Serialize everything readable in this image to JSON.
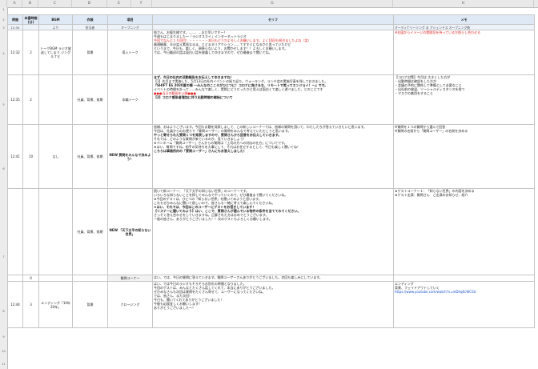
{
  "col_headers": [
    "",
    "A",
    "B",
    "C",
    "D",
    "E",
    "F",
    "G",
    "H"
  ],
  "row_numbers": [
    "1",
    "2",
    "3",
    "4",
    "5",
    "6",
    "7",
    "8",
    "9",
    "10",
    "11"
  ],
  "table": {
    "headers": [
      "時間",
      "本番時間(分)",
      "BGM",
      "衣装",
      "項目",
      "セリフ",
      "メモ"
    ],
    "sub_headers": [
      "",
      "",
      "より",
      "担当者",
      "オープニング",
      "",
      "オーディナリーソング ＆ アシェンドス オープニング曲"
    ],
    "sub_time": "12:30",
    "rows": [
      {
        "time": "12:32",
        "minutes": "2",
        "bgm": "トークBGM ラジオ放送してしまう ジングルナビ",
        "costume": "背景",
        "item": "導入トーク",
        "script": [
          {
            "t": "皆さん、お疲れ様です。……、…まだ早いですー！",
            "c": ""
          },
          {
            "t": "今週もはじまりました〜「ラジオスカイ」インターネットラジオ",
            "c": ""
          },
          {
            "t": "今回でなんと１０回目！・・・・・・本日もどうかよろしくお願いします。よく10回も続きましたよね（笑）",
            "c": "red"
          },
          {
            "t": "最通観客、半分笑え素直なまま、とどまるリアクション……てすすぐになるかと思っていたけど",
            "c": ""
          },
          {
            "t": "というまで、今日も、楽しく、頑張らないよう、お聞かせします！！よろしくお願いします。",
            "c": ""
          },
          {
            "t": "では、今日最初の話は面白い話を披露してゆきますので、ぜひ最後まで聞いてね。",
            "c": ""
          }
        ],
        "memo": [
          {
            "t": "※右図からイメージの雰囲気を持っているか照らし合わせる",
            "c": "red"
          }
        ]
      },
      {
        "time": "12:35",
        "minutes": "2",
        "bgm": "",
        "costume": "社員、背景、前期",
        "item": "本編トーク",
        "script": [
          {
            "t": "まず、今日の社内の活動報告をお伝えしてゆきますね！",
            "c": "bold"
          },
          {
            "t": "【1】先月まで実施した、5月13日の社内イベントの振り返り。ウォーキング、ランチ会の実施写真を残しておきました。",
            "c": ""
          },
          {
            "t": "『SHIFT ES  2020夏の陣 〜みんなのこころがひとつに！コロナに負けるな、リモートで笑ってエンジョイ！〜』です。",
            "c": "bold"
          },
          {
            "t": "イベントの時間を計って……みんなで楽しく、実際にどうだったかと思えば面白くて楽しく遊べました、とのことです",
            "c": ""
          },
          {
            "t": "●●●当日の動画を公開●●●",
            "c": "red"
          },
          {
            "t": "【2】コロナ感染者増加に伴う出勤時間の開始について",
            "c": "bold"
          }
        ],
        "memo": [
          {
            "t": "【コロナ対策】今月は 大きくした方が",
            "c": ""
          },
          {
            "t": "・出勤時間は確認をした方が",
            "c": ""
          },
          {
            "t": "・会議の予約に関係して準備として必要なこと",
            "c": ""
          },
          {
            "t": "・出社前の検温、ソーシャルディスタンスを保つ",
            "c": ""
          },
          {
            "t": "・マスクの着用をすること",
            "c": ""
          }
        ]
      },
      {
        "time": "12:41",
        "minutes": "10",
        "bgm": "なし",
        "costume": "社員、背景、前期",
        "item": "NEW 質問をみんなで決めよう！",
        "script": [
          {
            "t": "皆様、おはようございます。今回もお題を発表しまして、この新しいコーナーでは、皆様の質問を頂いて、わたしたちが答えていきたいと思います。",
            "c": ""
          },
          {
            "t": "今回は、社員からのお便りで「質問ユーザー」の質問をみんなで考えていただこうと思います。",
            "c": ""
          },
          {
            "t": "やっと寄せられた質問１つを発表しますので、質問さんから回答をお伝えしていきます。",
            "c": "bold"
          },
          {
            "t": "それでは、どのような質問が来ているのか、見ていきましょう！",
            "c": ""
          },
          {
            "t": "★ペンネーム「質問ユーザー」さんからの質問は「上司の方への対応の仕方」についてです。",
            "c": ""
          },
          {
            "t": "★はい、質問ですね。相手の気持ちを大事にして、それはお任せするとして、今日も楽しく聞いてね！",
            "c": ""
          },
          {
            "t": "こちらは事務所内の「質問ユーザー」さんにもお答えしました！",
            "c": "bold"
          }
        ],
        "memo": [
          {
            "t": "※質問を１つの質問から選んで回答",
            "c": ""
          },
          {
            "t": "※質問の名前から「質問ユーザー」の名前を決める",
            "c": ""
          }
        ]
      },
      {
        "time": "",
        "minutes": "",
        "bgm": "",
        "costume": "社員、背景、前期",
        "item": "NEW 「天下太平の知らない世界」",
        "script": [
          {
            "t": "続いて新コーナー、「天下太平の知らない世界」のコーナーです。",
            "c": ""
          },
          {
            "t": "いろいろな知らないことを探してみんなでやっていくので、ぜひ最後まで聞いてくださいね。",
            "c": ""
          },
          {
            "t": "★今回のゲストは、ひとつの「知らない世界」を聞いてみようと思います。",
            "c": ""
          },
          {
            "t": "これもぜひみんなに聞いて欲しいので、皆さんも一緒に考えて楽しんでくださいね。",
            "c": ""
          },
          {
            "t": "★はい、それでは、今回はこのユーザーにゲストをお招きしています！",
            "c": "bold"
          },
          {
            "t": "【リスナーに聞いてみよう】はい、ここで、質問さんが選んでいる物件の条件を当ててみてください。",
            "c": "bold"
          },
          {
            "t": "さっそく答え合わせをしていきますね。正解された方はおめでとうございます。",
            "c": ""
          },
          {
            "t": "一般の皆さん、ありがとうございました！！次のゲストもよろしくお願いします。",
            "c": ""
          }
        ],
        "memo": [
          {
            "t": "★ゲストコーナー１：「知らない世界」の内容を決める",
            "c": ""
          },
          {
            "t": "★ゲスト出演：質問さん　ご出演のお知らせ、紹介",
            "c": ""
          }
        ]
      },
      {
        "time": "",
        "minutes": "0",
        "bgm": "",
        "costume": "",
        "item": "質問コーナー",
        "script": [
          {
            "t": "はい、では、今日の質問に答えていきます。質問ユーザーさんありがとうございました。次回も楽しみにしています。",
            "c": ""
          }
        ],
        "memo": []
      },
      {
        "time": "12:44",
        "minutes": "3",
        "bgm": "エンディング「10年20年」",
        "costume": "背景",
        "item": "クロージング",
        "script": [
          {
            "t": "はい、では今日のラジオもそろそろお別れの時間となりました。",
            "c": ""
          },
          {
            "t": "今回のゲストは、みんなとたくさん話してくれて、本当にありがとうございました。",
            "c": ""
          },
          {
            "t": "ぜひみなさんも次回は質問をたくさん寄せて、ユーザーになってくださいね。",
            "c": ""
          },
          {
            "t": "では、皆さん、また次回！",
            "c": ""
          },
          {
            "t": "今日も、聞いてくれてありがとうございました！",
            "c": ""
          },
          {
            "t": "今後も応援宜しくお願いします！",
            "c": ""
          },
          {
            "t": "ありがとうございました〜！",
            "c": ""
          }
        ],
        "memo": [
          {
            "t": "エンディング",
            "c": ""
          },
          {
            "t": "背景、フェイドアウトしていく",
            "c": ""
          },
          {
            "t": "https://www.youtube.com/watch?v=mDhq6cWCSU",
            "c": "blue"
          }
        ]
      }
    ]
  }
}
